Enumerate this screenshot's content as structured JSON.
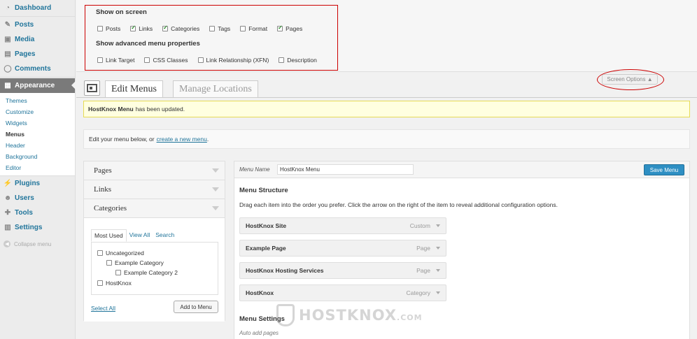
{
  "sidebar": {
    "items": [
      {
        "label": "Dashboard",
        "icon": "dashboard-icon"
      },
      {
        "label": "Posts",
        "icon": "pin-icon"
      },
      {
        "label": "Media",
        "icon": "media-icon"
      },
      {
        "label": "Pages",
        "icon": "page-icon"
      },
      {
        "label": "Comments",
        "icon": "comment-icon"
      },
      {
        "label": "Appearance",
        "icon": "brush-icon"
      }
    ],
    "appearance_sub": [
      "Themes",
      "Customize",
      "Widgets",
      "Menus",
      "Header",
      "Background",
      "Editor"
    ],
    "items_after": [
      {
        "label": "Plugins",
        "icon": "plugin-icon"
      },
      {
        "label": "Users",
        "icon": "users-icon"
      },
      {
        "label": "Tools",
        "icon": "tools-icon"
      },
      {
        "label": "Settings",
        "icon": "settings-icon"
      }
    ],
    "collapse_label": "Collapse menu"
  },
  "screen_options": {
    "show_on_screen": "Show on screen",
    "show_opts": [
      {
        "label": "Posts",
        "checked": false
      },
      {
        "label": "Links",
        "checked": true
      },
      {
        "label": "Categories",
        "checked": true
      },
      {
        "label": "Tags",
        "checked": false
      },
      {
        "label": "Format",
        "checked": false
      },
      {
        "label": "Pages",
        "checked": true
      }
    ],
    "advanced_heading": "Show advanced menu properties",
    "advanced_opts": [
      {
        "label": "Link Target",
        "checked": false
      },
      {
        "label": "CSS Classes",
        "checked": false
      },
      {
        "label": "Link Relationship (XFN)",
        "checked": false
      },
      {
        "label": "Description",
        "checked": false
      }
    ],
    "tab_label": "Screen Options ▲"
  },
  "tabs": {
    "edit": "Edit Menus",
    "locations": "Manage Locations"
  },
  "notice": {
    "menu_name": "HostKnox Menu",
    "text": "has been updated."
  },
  "manage": {
    "text": "Edit your menu below, or",
    "link": "create a new menu",
    "suffix": "."
  },
  "accordion": {
    "pages": "Pages",
    "links": "Links",
    "categories": "Categories",
    "cat_tabs": [
      "Most Used",
      "View All",
      "Search"
    ],
    "cat_items": [
      "Uncategorized",
      "Example Category",
      "Example Category 2",
      "HostKnox"
    ],
    "select_all": "Select All",
    "add_button": "Add to Menu"
  },
  "menu": {
    "name_label": "Menu Name",
    "name_value": "HostKnox Menu",
    "save_label": "Save Menu",
    "structure_heading": "Menu Structure",
    "structure_desc": "Drag each item into the order you prefer. Click the arrow on the right of the item to reveal additional configuration options.",
    "items": [
      {
        "title": "HostKnox Site",
        "type": "Custom"
      },
      {
        "title": "Example Page",
        "type": "Page"
      },
      {
        "title": "HostKnox Hosting Services",
        "type": "Page"
      },
      {
        "title": "HostKnox",
        "type": "Category"
      }
    ],
    "settings_heading": "Menu Settings",
    "auto_add": "Auto add pages"
  },
  "watermark": {
    "text": "HOSTKNOX",
    "suffix": ".COM"
  }
}
